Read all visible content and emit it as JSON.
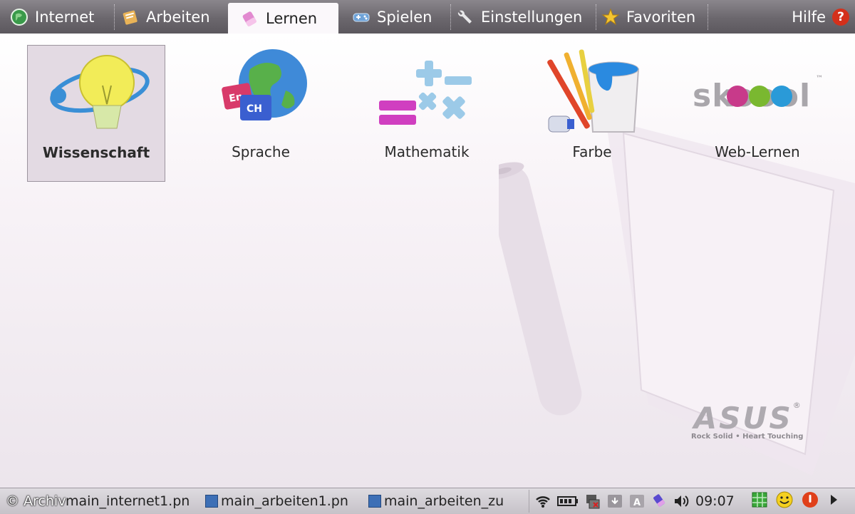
{
  "tabs": [
    {
      "label": "Internet",
      "icon": "globe-icon"
    },
    {
      "label": "Arbeiten",
      "icon": "document-icon"
    },
    {
      "label": "Lernen",
      "icon": "eraser-icon",
      "active": true
    },
    {
      "label": "Spielen",
      "icon": "gamepad-icon"
    },
    {
      "label": "Einstellungen",
      "icon": "wrench-icon"
    },
    {
      "label": "Favoriten",
      "icon": "star-icon"
    }
  ],
  "help": {
    "label": "Hilfe",
    "icon": "question-icon",
    "glyph": "?"
  },
  "apps": [
    {
      "label": "Wissenschaft",
      "icon": "lightbulb-icon",
      "selected": true
    },
    {
      "label": "Sprache",
      "icon": "globe-language-icon"
    },
    {
      "label": "Mathematik",
      "icon": "math-symbols-icon"
    },
    {
      "label": "Farbe",
      "icon": "paint-bucket-icon"
    },
    {
      "label": "Web-Lernen",
      "icon": "skoool-logo",
      "logo_text": "skoool",
      "logo_mark": "™"
    }
  ],
  "language_badges": {
    "first": "En",
    "second": "CH"
  },
  "brand": {
    "logo": "ASUS",
    "tagline": "Rock Solid • Heart Touching",
    "registered": "®"
  },
  "taskbar": {
    "copyright": "© Archiv",
    "windows": [
      {
        "label": "main_internet1.pn"
      },
      {
        "label": "main_arbeiten1.pn"
      },
      {
        "label": "main_arbeiten_zu"
      }
    ],
    "clock": "09:07",
    "tray_icons": [
      "wifi-icon",
      "battery-icon",
      "network-icon",
      "keyboard-icon",
      "input-method-icon",
      "eraser-icon",
      "volume-icon"
    ],
    "right_icons": [
      "grid-icon",
      "smiley-icon",
      "power-icon",
      "arrow-right-icon"
    ]
  },
  "colors": {
    "accent": "#d4301b",
    "topbar": "#6b676d",
    "active_tab": "#fbf8fb"
  }
}
